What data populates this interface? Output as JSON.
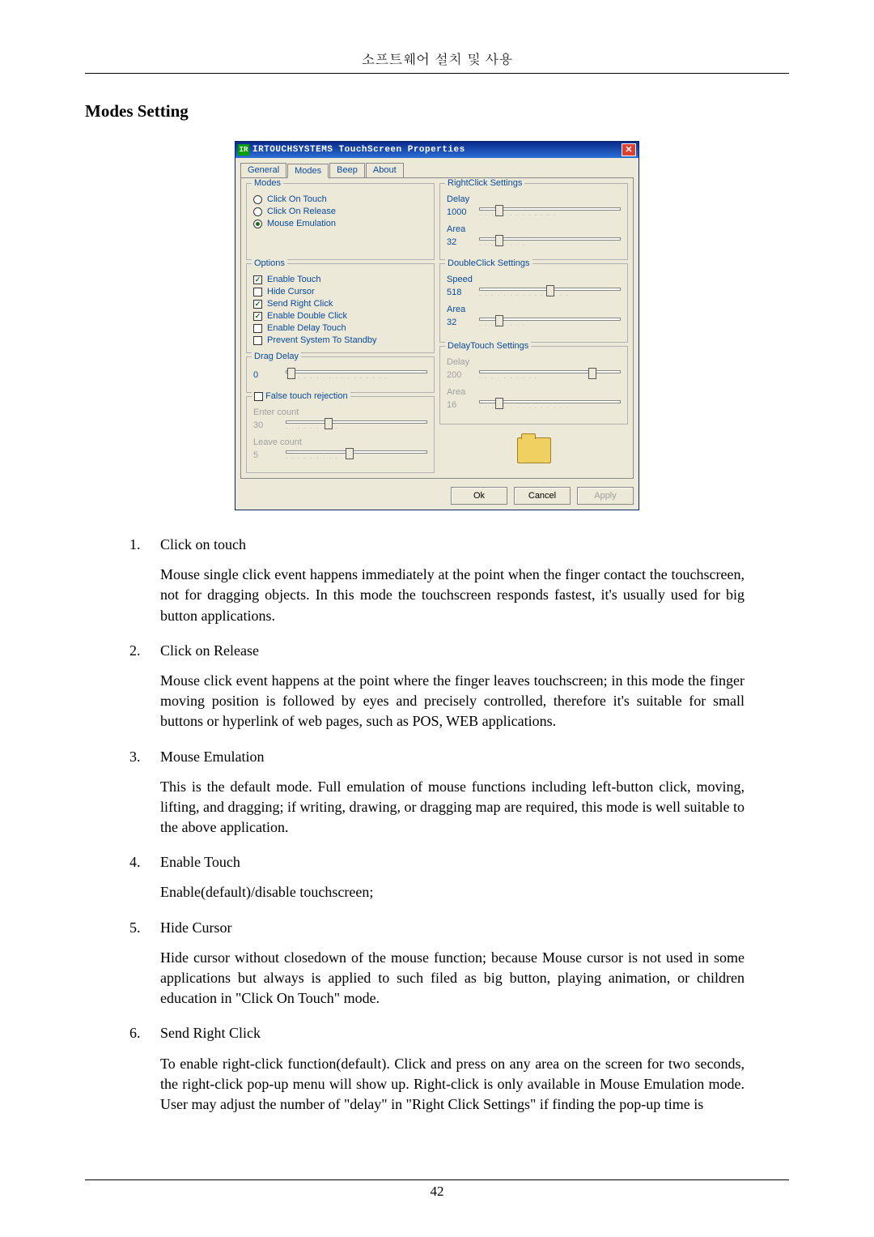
{
  "header": "소프트웨어 설치 및 사용",
  "section_title": "Modes Setting",
  "dialog": {
    "title": "IRTOUCHSYSTEMS TouchScreen Properties",
    "icon_text": "IR",
    "tabs": [
      "General",
      "Modes",
      "Beep",
      "About"
    ],
    "active_tab": 1,
    "modes_group": {
      "legend": "Modes",
      "radios": [
        {
          "label": "Click On Touch",
          "selected": false
        },
        {
          "label": "Click On Release",
          "selected": false
        },
        {
          "label": "Mouse Emulation",
          "selected": true
        }
      ]
    },
    "options_group": {
      "legend": "Options",
      "checks": [
        {
          "label": "Enable Touch",
          "checked": true,
          "enabled": true
        },
        {
          "label": "Hide Cursor",
          "checked": false,
          "enabled": true
        },
        {
          "label": "Send Right Click",
          "checked": true,
          "enabled": true
        },
        {
          "label": "Enable Double Click",
          "checked": true,
          "enabled": true
        },
        {
          "label": "Enable Delay Touch",
          "checked": false,
          "enabled": true
        },
        {
          "label": "Prevent System To Standby",
          "checked": false,
          "enabled": true
        }
      ]
    },
    "dragdelay_group": {
      "legend": "Drag Delay",
      "value": "0",
      "thumb": 4
    },
    "falsetouch_group": {
      "legend": "False touch rejection",
      "enabled": false,
      "checked": false,
      "enter_label": "Enter count",
      "enter_value": "30",
      "leave_label": "Leave count",
      "leave_value": "5"
    },
    "rightclick_group": {
      "legend": "RightClick Settings",
      "enabled": true,
      "delay_label": "Delay",
      "delay_value": "1000",
      "delay_thumb": 14,
      "area_label": "Area",
      "area_value": "32",
      "area_thumb": 14
    },
    "doubleclick_group": {
      "legend": "DoubleClick Settings",
      "enabled": true,
      "speed_label": "Speed",
      "speed_value": "518",
      "speed_thumb": 50,
      "area_label": "Area",
      "area_value": "32",
      "area_thumb": 14
    },
    "delaytouch_group": {
      "legend": "DelayTouch Settings",
      "enabled": false,
      "delay_label": "Delay",
      "delay_value": "200",
      "delay_thumb": 80,
      "area_label": "Area",
      "area_value": "16",
      "area_thumb": 14
    },
    "buttons": {
      "ok": "Ok",
      "cancel": "Cancel",
      "apply": "Apply"
    }
  },
  "list": [
    {
      "num": "1.",
      "title": "Click on touch",
      "body": "Mouse single click event happens immediately at the point when the finger contact the touchscreen, not for dragging objects. In this mode the touchscreen responds fastest, it's usually used for big button applications."
    },
    {
      "num": "2.",
      "title": "Click on Release",
      "body": "Mouse click event happens at the point where the finger leaves touchscreen; in this mode the finger moving position is followed by eyes and precisely controlled, therefore it's suitable for small buttons or hyperlink of web pages, such as POS, WEB applications."
    },
    {
      "num": "3.",
      "title": "Mouse Emulation",
      "body": "This is the default mode. Full emulation of mouse functions including left-button click, moving, lifting, and dragging; if writing, drawing, or dragging map are required, this mode is well suitable to the above application."
    },
    {
      "num": "4.",
      "title": "Enable Touch",
      "body": "Enable(default)/disable touchscreen;"
    },
    {
      "num": "5.",
      "title": "Hide Cursor",
      "body": "Hide cursor without closedown of the mouse function; because Mouse cursor is not used in some applications but always is applied to such filed as big button, playing animation, or children education in \"Click On Touch\" mode."
    },
    {
      "num": "6.",
      "title": "Send Right Click",
      "body": "To enable right-click function(default). Click and press on any area on the screen for two seconds, the right-click pop-up menu will show up. Right-click is only available in Mouse Emulation mode. User may adjust the number of \"delay\" in \"Right Click Settings\" if finding the pop-up time is"
    }
  ],
  "page_number": "42"
}
